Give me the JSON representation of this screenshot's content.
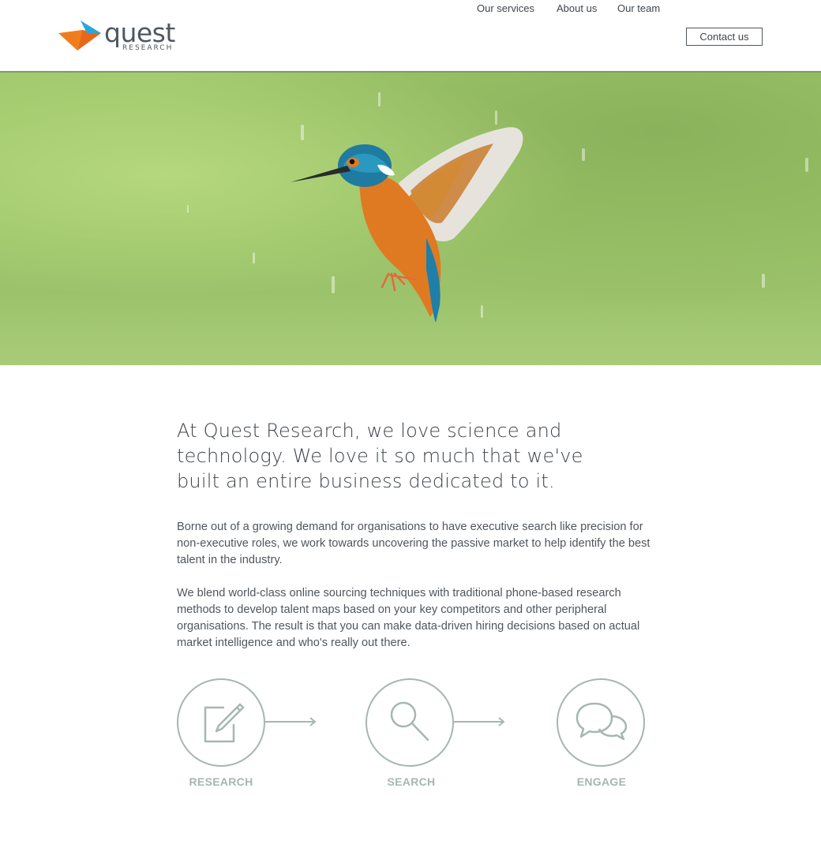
{
  "brand": {
    "name": "quest",
    "subtitle": "RESEARCH",
    "logo_colors": {
      "orange": "#f07d1c",
      "blue": "#2aa7d9"
    }
  },
  "nav": {
    "items": [
      {
        "label": "Our services"
      },
      {
        "label": "About us"
      },
      {
        "label": "Our team"
      }
    ],
    "contact_label": "Contact us"
  },
  "hero": {
    "image": "kingfisher-in-flight",
    "background_color": "#9fc769"
  },
  "main": {
    "headline": "At Quest Research, we love science and technology. We love it so much that we've built an entire business dedicated to it.",
    "paragraphs": [
      "Borne out of a growing demand for organisations to have executive search like precision for non-executive roles, we work towards uncovering the passive market to help identify the best talent in the industry.",
      "We blend world-class online sourcing techniques with traditional phone-based research methods to develop talent maps based on your key competitors and other peripheral organisations. The result is that you can make data-driven hiring decisions based on actual market intelligence and who's really out there."
    ]
  },
  "process": {
    "steps": [
      {
        "label": "RESEARCH",
        "icon": "edit-icon"
      },
      {
        "label": "SEARCH",
        "icon": "magnifier-icon"
      },
      {
        "label": "ENGAGE",
        "icon": "chat-bubbles-icon"
      }
    ],
    "accent_color": "#a7b6b3"
  }
}
